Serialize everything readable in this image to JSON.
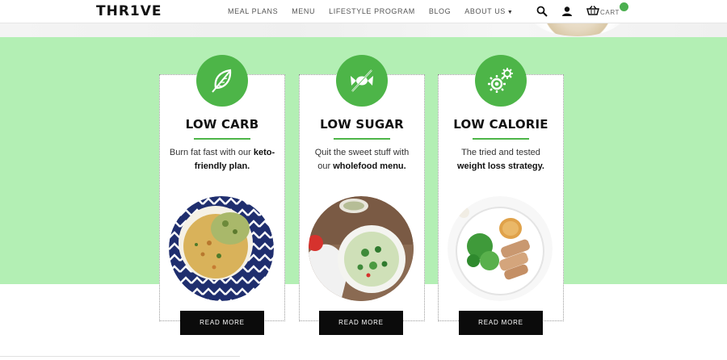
{
  "header": {
    "logo": "THR1VE",
    "nav": [
      {
        "label": "MEAL PLANS"
      },
      {
        "label": "MENU"
      },
      {
        "label": "LIFESTYLE PROGRAM"
      },
      {
        "label": "BLOG"
      },
      {
        "label": "ABOUT US",
        "has_dropdown": true
      }
    ],
    "search_icon": "search-icon",
    "account_icon": "user-icon",
    "cart_icon": "cart-icon",
    "cart_label": "CART"
  },
  "colors": {
    "accent": "#4db548",
    "band": "#b3efb4",
    "button": "#0b0b0b",
    "cart_dot": "#4caf50"
  },
  "cards": [
    {
      "icon": "leaf-icon",
      "title": "LOW CARB",
      "desc_plain": "Burn fat fast with our",
      "desc_bold": "keto-friendly plan.",
      "button": "READ MORE"
    },
    {
      "icon": "candy-crossed-icon",
      "title": "LOW SUGAR",
      "desc_plain": "Quit the sweet stuff with our",
      "desc_bold": "wholefood menu.",
      "button": "READ MORE"
    },
    {
      "icon": "gears-icon",
      "title": "LOW CALORIE",
      "desc_plain": "The tried and tested",
      "desc_bold": "weight loss strategy.",
      "button": "READ MORE"
    }
  ]
}
